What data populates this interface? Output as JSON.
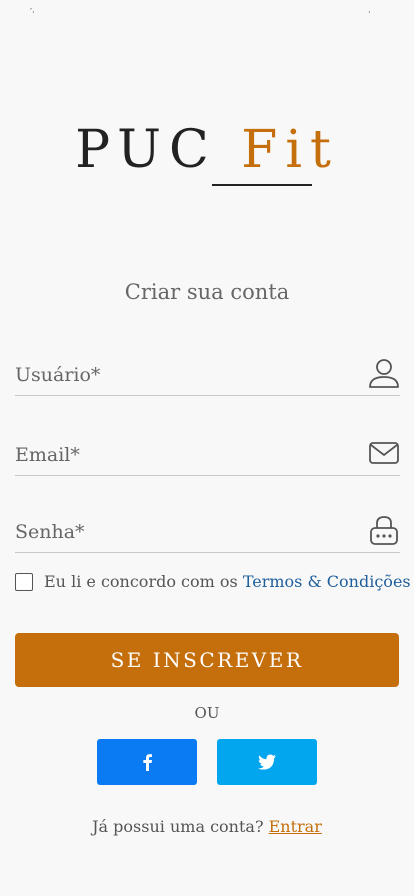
{
  "status_bar": {
    "left_glyph": "′·",
    "right_glyph": "·"
  },
  "logo": {
    "part1": "PUC ",
    "part2": "Fit"
  },
  "subtitle": "Criar sua conta",
  "form": {
    "username": {
      "placeholder": "Usuário*",
      "value": "",
      "icon": "user-icon"
    },
    "email": {
      "placeholder": "Email*",
      "value": "",
      "icon": "envelope-icon"
    },
    "password": {
      "placeholder": "Senha*",
      "value": "",
      "icon": "lock-icon"
    },
    "terms": {
      "checked": false,
      "text": "Eu li e concordo com os ",
      "link": "Termos & Condições"
    },
    "submit_label": "SE INSCREVER"
  },
  "divider": "OU",
  "social": [
    {
      "name": "facebook",
      "icon": "facebook-icon",
      "color": "#0a7bf2"
    },
    {
      "name": "twitter",
      "icon": "twitter-icon",
      "color": "#02a6ee"
    }
  ],
  "login": {
    "prompt": "Já possui uma conta? ",
    "link": "Entrar"
  },
  "colors": {
    "accent": "#c56f0c",
    "link": "#1f5e9c",
    "background": "#f8f8f8"
  }
}
